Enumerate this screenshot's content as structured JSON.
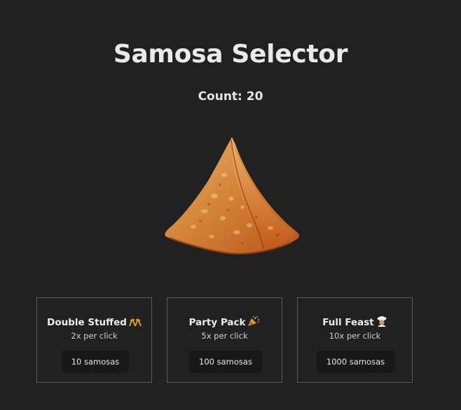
{
  "app": {
    "title": "Samosa Selector",
    "count_label": "Count: 20"
  },
  "samosa": {
    "icon": "samosa-image"
  },
  "upgrades": [
    {
      "name": "Double Stuffed",
      "emoji": "dancers-icon",
      "rate": "2x per click",
      "cost": "10 samosas"
    },
    {
      "name": "Party Pack",
      "emoji": "party-popper-icon",
      "rate": "5x per click",
      "cost": "100 samosas"
    },
    {
      "name": "Full Feast",
      "emoji": "chef-icon",
      "rate": "10x per click",
      "cost": "1000 samosas"
    }
  ],
  "colors": {
    "background": "#212121",
    "card_border": "#5a5a5a",
    "button_bg": "#181818",
    "text": "#e6e6e6"
  }
}
